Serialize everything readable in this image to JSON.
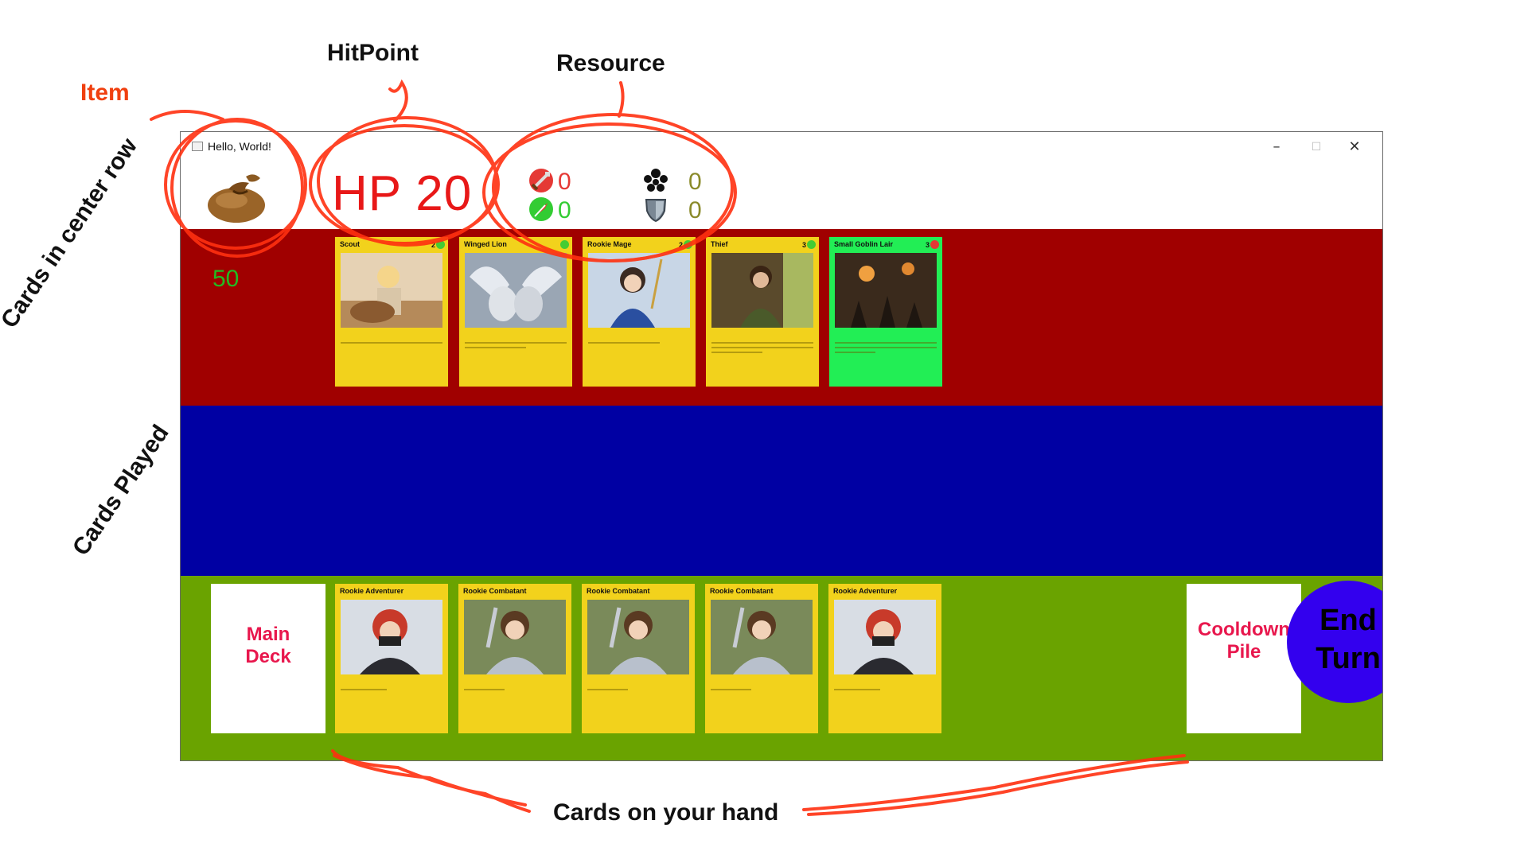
{
  "window": {
    "title": "Hello, World!"
  },
  "hud": {
    "hp": "HP 20",
    "gold": "50",
    "resources": [
      {
        "icon": "sword-icon",
        "value": "0",
        "color": "#e53935"
      },
      {
        "icon": "compass-icon",
        "value": "0",
        "color": "#33cc33"
      },
      {
        "icon": "people-icon",
        "value": "0",
        "color": "#8a8a2a"
      },
      {
        "icon": "shield-icon",
        "value": "0",
        "color": "#8a8a2a"
      }
    ]
  },
  "center_row": {
    "cards": [
      {
        "name": "Scout",
        "cost": "2",
        "color": "yellow"
      },
      {
        "name": "Winged Lion",
        "cost": "",
        "color": "yellow"
      },
      {
        "name": "Rookie Mage",
        "cost": "2",
        "color": "yellow"
      },
      {
        "name": "Thief",
        "cost": "3",
        "color": "yellow"
      },
      {
        "name": "Small Goblin Lair",
        "cost": "3",
        "color": "green"
      }
    ]
  },
  "hand": {
    "main_deck": [
      "Main",
      "Deck"
    ],
    "cooldown_pile": [
      "Cooldown",
      "Pile"
    ],
    "end_turn": [
      "End",
      "Turn"
    ],
    "cards": [
      {
        "name": "Rookie Adventurer"
      },
      {
        "name": "Rookie Combatant"
      },
      {
        "name": "Rookie Combatant"
      },
      {
        "name": "Rookie Combatant"
      },
      {
        "name": "Rookie Adventurer"
      }
    ]
  },
  "annotations": {
    "item": "Item",
    "hitpoint": "HitPoint",
    "resource": "Resource",
    "center_row": "Cards in center row",
    "played": "Cards Played",
    "hand": "Cards on your hand"
  },
  "colors": {
    "center_row": "#a00000",
    "played_row": "#0000a3",
    "hand_row": "#6aa300",
    "card": "#f2d21c",
    "location_card": "#22ee55",
    "end_turn": "#3300ee",
    "pile_text": "#e8174d",
    "hp_text": "#e81818",
    "annotation_scribble": "#ff3010"
  }
}
